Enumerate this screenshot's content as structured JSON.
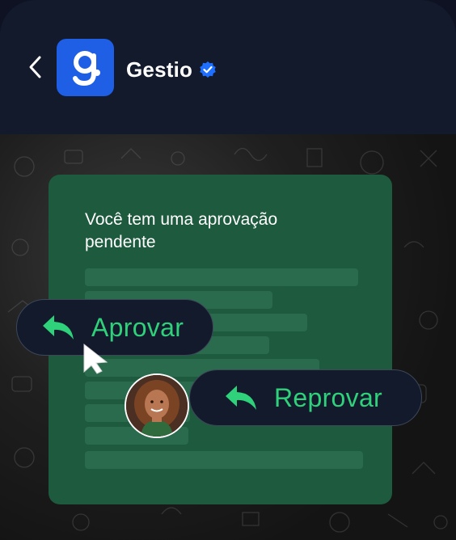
{
  "header": {
    "title": "Gestio",
    "logo_letter": "g"
  },
  "card": {
    "heading": "Você tem uma aprovação pendente"
  },
  "actions": {
    "approve_label": "Aprovar",
    "reject_label": "Reprovar"
  },
  "colors": {
    "header_bg": "#121a2c",
    "logo_bg": "#1f5fe6",
    "card_bg": "#1d5a3e",
    "accent_green": "#2fd17a",
    "verified_blue": "#1f6fff"
  },
  "icons": {
    "back": "chevron-left-icon",
    "verified": "verified-badge-icon",
    "reply": "reply-arrow-icon",
    "cursor": "mouse-pointer-icon"
  }
}
